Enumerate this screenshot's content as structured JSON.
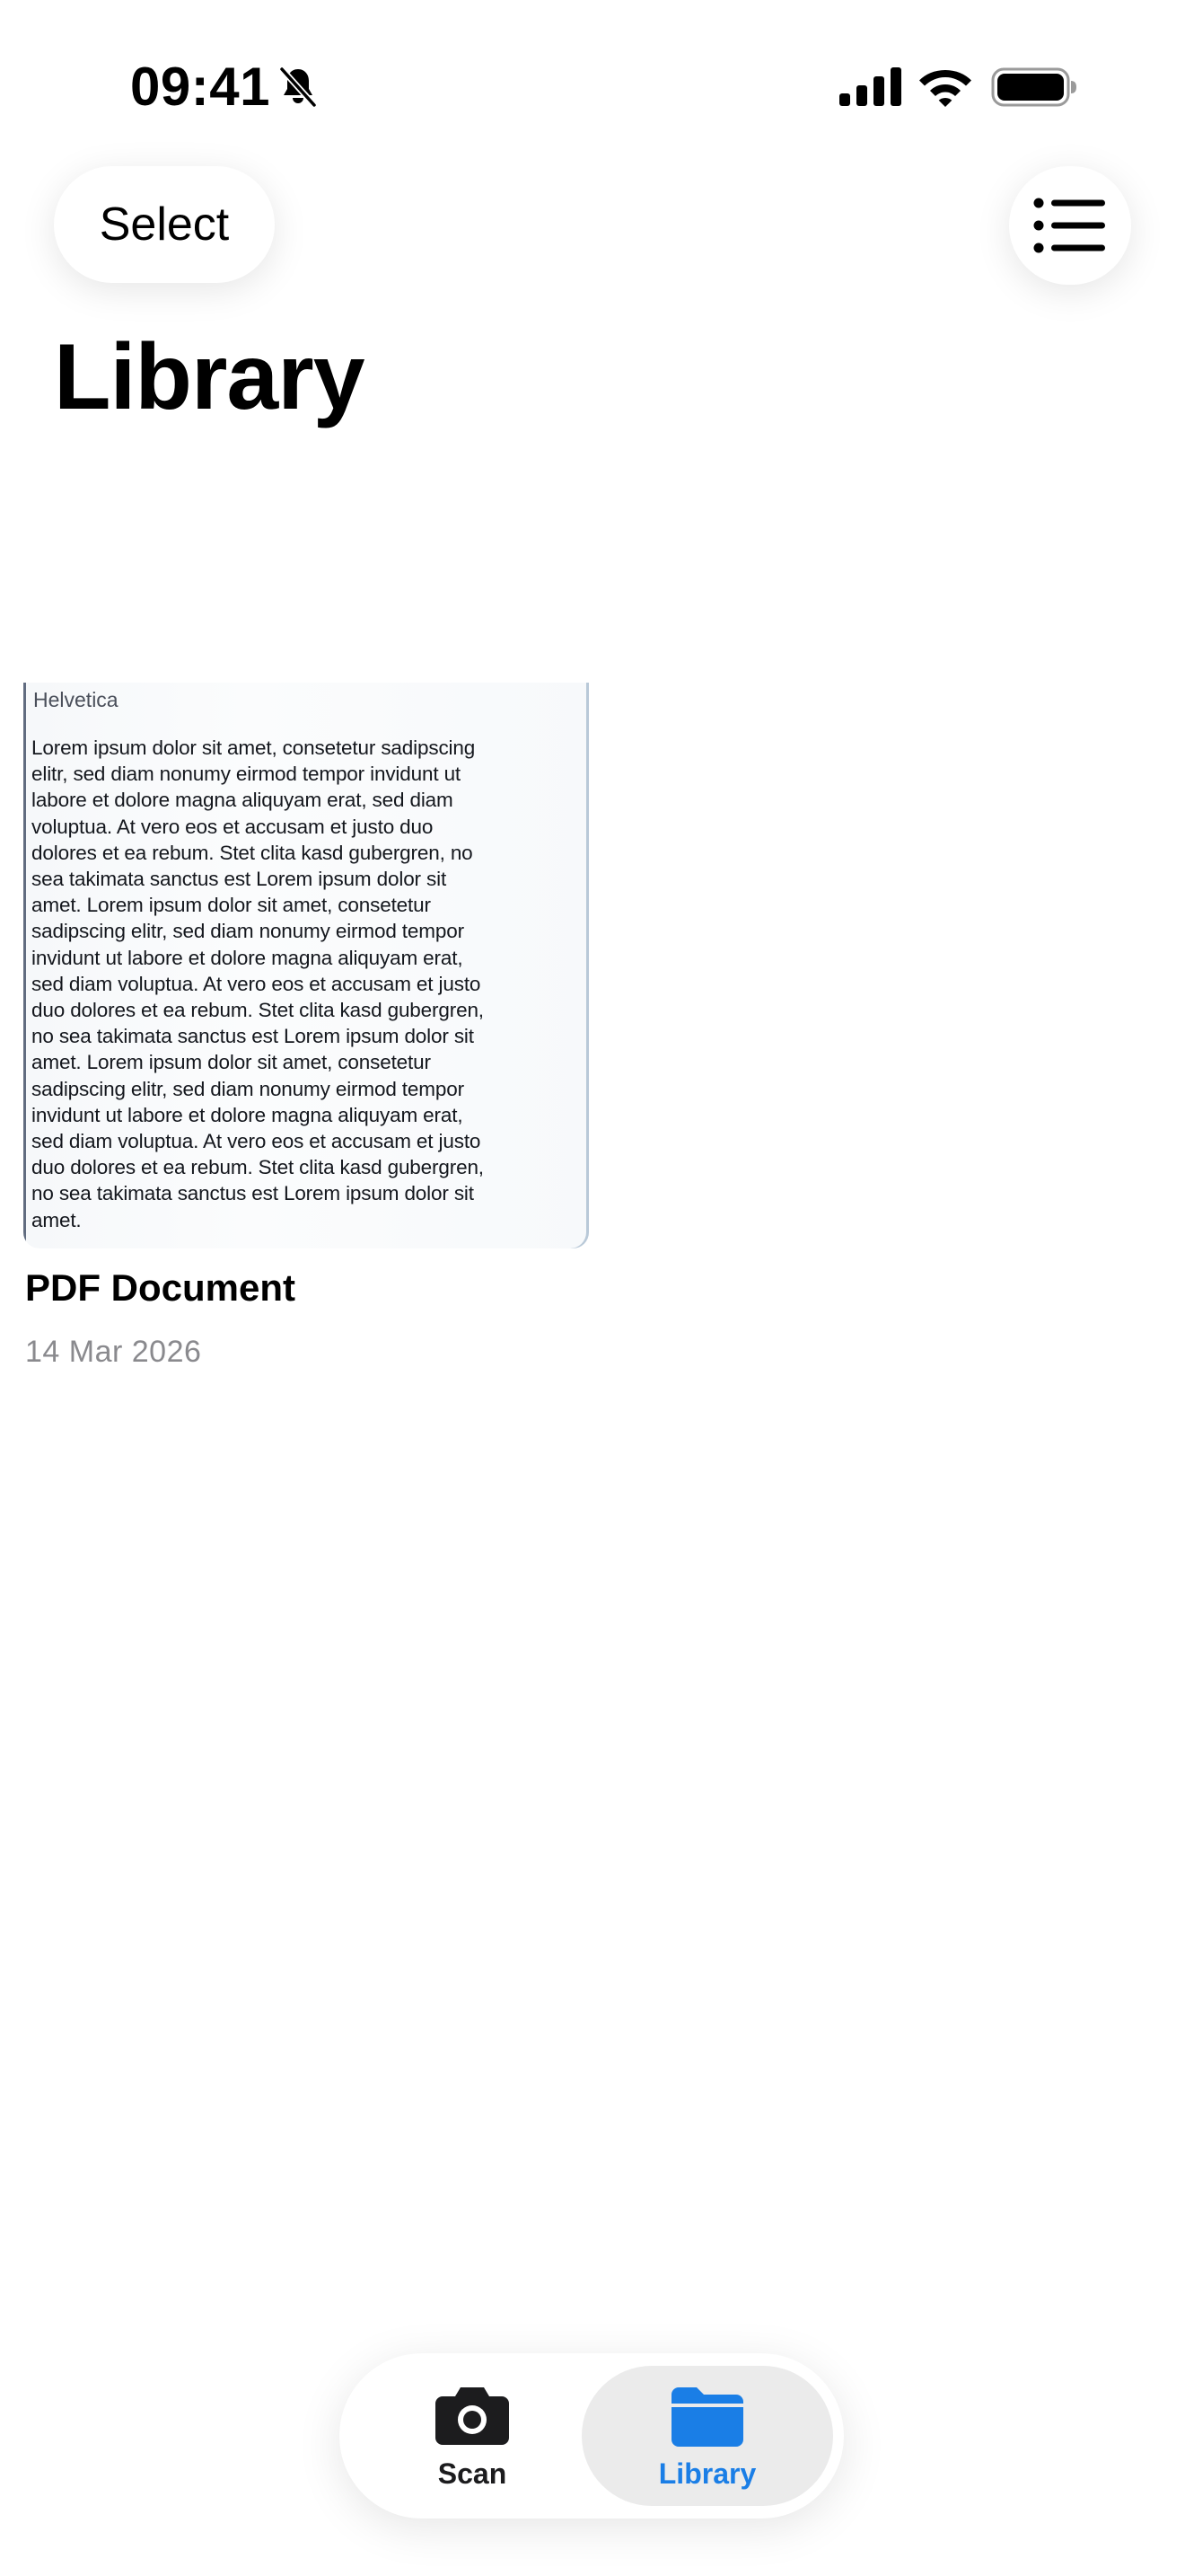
{
  "status_bar": {
    "time": "09:41",
    "icons": [
      "bell-slash-icon",
      "cellular-signal-icon",
      "wifi-icon",
      "battery-icon"
    ]
  },
  "header": {
    "select_label": "Select",
    "list_icon": "list-bullet-icon",
    "title": "Library"
  },
  "documents": [
    {
      "title": "PDF Document",
      "date": "14 Mar 2026",
      "thumbnail": {
        "font_label": "Helvetica",
        "body": "Lorem ipsum dolor sit amet, consetetur sadipscing\nelitr, sed diam nonumy eirmod tempor invidunt ut\nlabore et dolore magna aliquyam erat, sed diam\nvoluptua. At vero eos et accusam et justo duo\ndolores et ea rebum. Stet clita kasd gubergren, no\nsea takimata sanctus est Lorem ipsum dolor sit\namet. Lorem ipsum dolor sit amet, consetetur\nsadipscing elitr, sed diam nonumy eirmod tempor\ninvidunt ut labore et dolore magna aliquyam erat,\nsed diam voluptua. At vero eos et accusam et justo\nduo dolores et ea rebum. Stet clita kasd gubergren,\nno sea takimata sanctus est Lorem ipsum dolor sit\namet. Lorem ipsum dolor sit amet, consetetur\nsadipscing elitr, sed diam nonumy eirmod tempor\ninvidunt ut labore et dolore magna aliquyam erat,\nsed diam voluptua. At vero eos et accusam et justo\nduo dolores et ea rebum. Stet clita kasd gubergren,\nno sea takimata sanctus est Lorem ipsum dolor sit\namet."
      }
    }
  ],
  "tab_bar": {
    "tabs": [
      {
        "label": "Scan",
        "icon": "camera-icon",
        "selected": false
      },
      {
        "label": "Library",
        "icon": "folder-icon",
        "selected": true
      }
    ]
  },
  "colors": {
    "accent": "#1a7ee6",
    "selected_tab_bg": "#ebebeb",
    "secondary_text": "#8a8a8e"
  }
}
